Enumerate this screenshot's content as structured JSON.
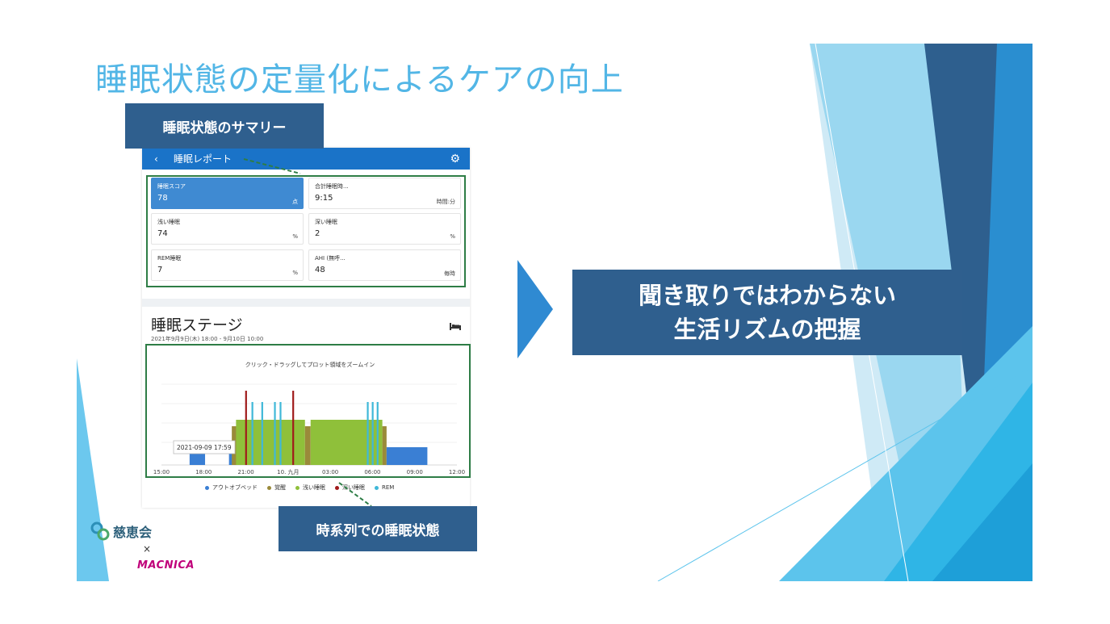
{
  "slide": {
    "title": "睡眠状態の定量化によるケアの向上",
    "callout_summary": "睡眠状態のサマリー",
    "callout_timeseries": "時系列での睡眠状態",
    "callout_main_line1": "聞き取りではわからない",
    "callout_main_line2": "生活リズムの把握"
  },
  "app": {
    "header": {
      "back_icon": "‹",
      "title": "睡眠レポート",
      "gear_icon": "⚙"
    },
    "metrics": [
      {
        "label": "睡眠スコア",
        "value": "78",
        "unit": "点"
      },
      {
        "label": "合計睡眠時...",
        "value": "9:15",
        "unit": "時間:分"
      },
      {
        "label": "浅い睡眠",
        "value": "74",
        "unit": "%"
      },
      {
        "label": "深い睡眠",
        "value": "2",
        "unit": "%"
      },
      {
        "label": "REM睡眠",
        "value": "7",
        "unit": "%"
      },
      {
        "label": "AHI (無呼...",
        "value": "48",
        "unit": "毎時"
      }
    ],
    "stage": {
      "title": "睡眠ステージ",
      "date_range": "2021年9月9日(木) 18:00 - 9月10日 10:00",
      "bed_icon": "bed-icon"
    }
  },
  "chart_data": {
    "type": "bar",
    "title": "クリック・ドラッグしてプロット領域をズームイン",
    "tooltip": "2021-09-09 17:59",
    "x_ticks": [
      "15:00",
      "18:00",
      "21:00",
      "10. 九月",
      "03:00",
      "06:00",
      "09:00",
      "12:00"
    ],
    "x_range_hours": [
      15,
      36
    ],
    "legend": [
      {
        "name": "アウトオブベッド",
        "color": "#3a7fd4"
      },
      {
        "name": "覚醒",
        "color": "#9a8a3a"
      },
      {
        "name": "浅い睡眠",
        "color": "#8fc03a"
      },
      {
        "name": "深い睡眠",
        "color": "#a01b1b"
      },
      {
        "name": "REM",
        "color": "#3fb8d8"
      }
    ],
    "segments": [
      {
        "stage": "アウトオブベッド",
        "start": 17.0,
        "end": 18.1
      },
      {
        "stage": "アウトオブベッド",
        "start": 19.8,
        "end": 20.3
      },
      {
        "stage": "覚醒",
        "start": 20.0,
        "end": 20.4
      },
      {
        "stage": "浅い睡眠",
        "start": 20.3,
        "end": 25.2
      },
      {
        "stage": "覚醒",
        "start": 25.2,
        "end": 25.6
      },
      {
        "stage": "浅い睡眠",
        "start": 25.6,
        "end": 30.7
      },
      {
        "stage": "覚醒",
        "start": 30.7,
        "end": 31.0
      },
      {
        "stage": "アウトオブベッド",
        "start": 31.0,
        "end": 33.9
      }
    ],
    "spikes": [
      {
        "stage": "深い睡眠",
        "at": 20.95
      },
      {
        "stage": "REM",
        "at": 21.4
      },
      {
        "stage": "REM",
        "at": 22.1
      },
      {
        "stage": "REM",
        "at": 23.0
      },
      {
        "stage": "REM",
        "at": 23.4
      },
      {
        "stage": "深い睡眠",
        "at": 24.3
      },
      {
        "stage": "REM",
        "at": 29.6
      },
      {
        "stage": "REM",
        "at": 29.95
      },
      {
        "stage": "REM",
        "at": 30.3
      }
    ]
  },
  "logos": {
    "org": "慈恵会",
    "times": "×",
    "company": "MACNICA"
  },
  "colors": {
    "title": "#52b6e6",
    "callout": "#2f5f8e",
    "appbar": "#1a73c8",
    "highlight_card": "#3f8ad2",
    "frame": "#2e7d46"
  }
}
